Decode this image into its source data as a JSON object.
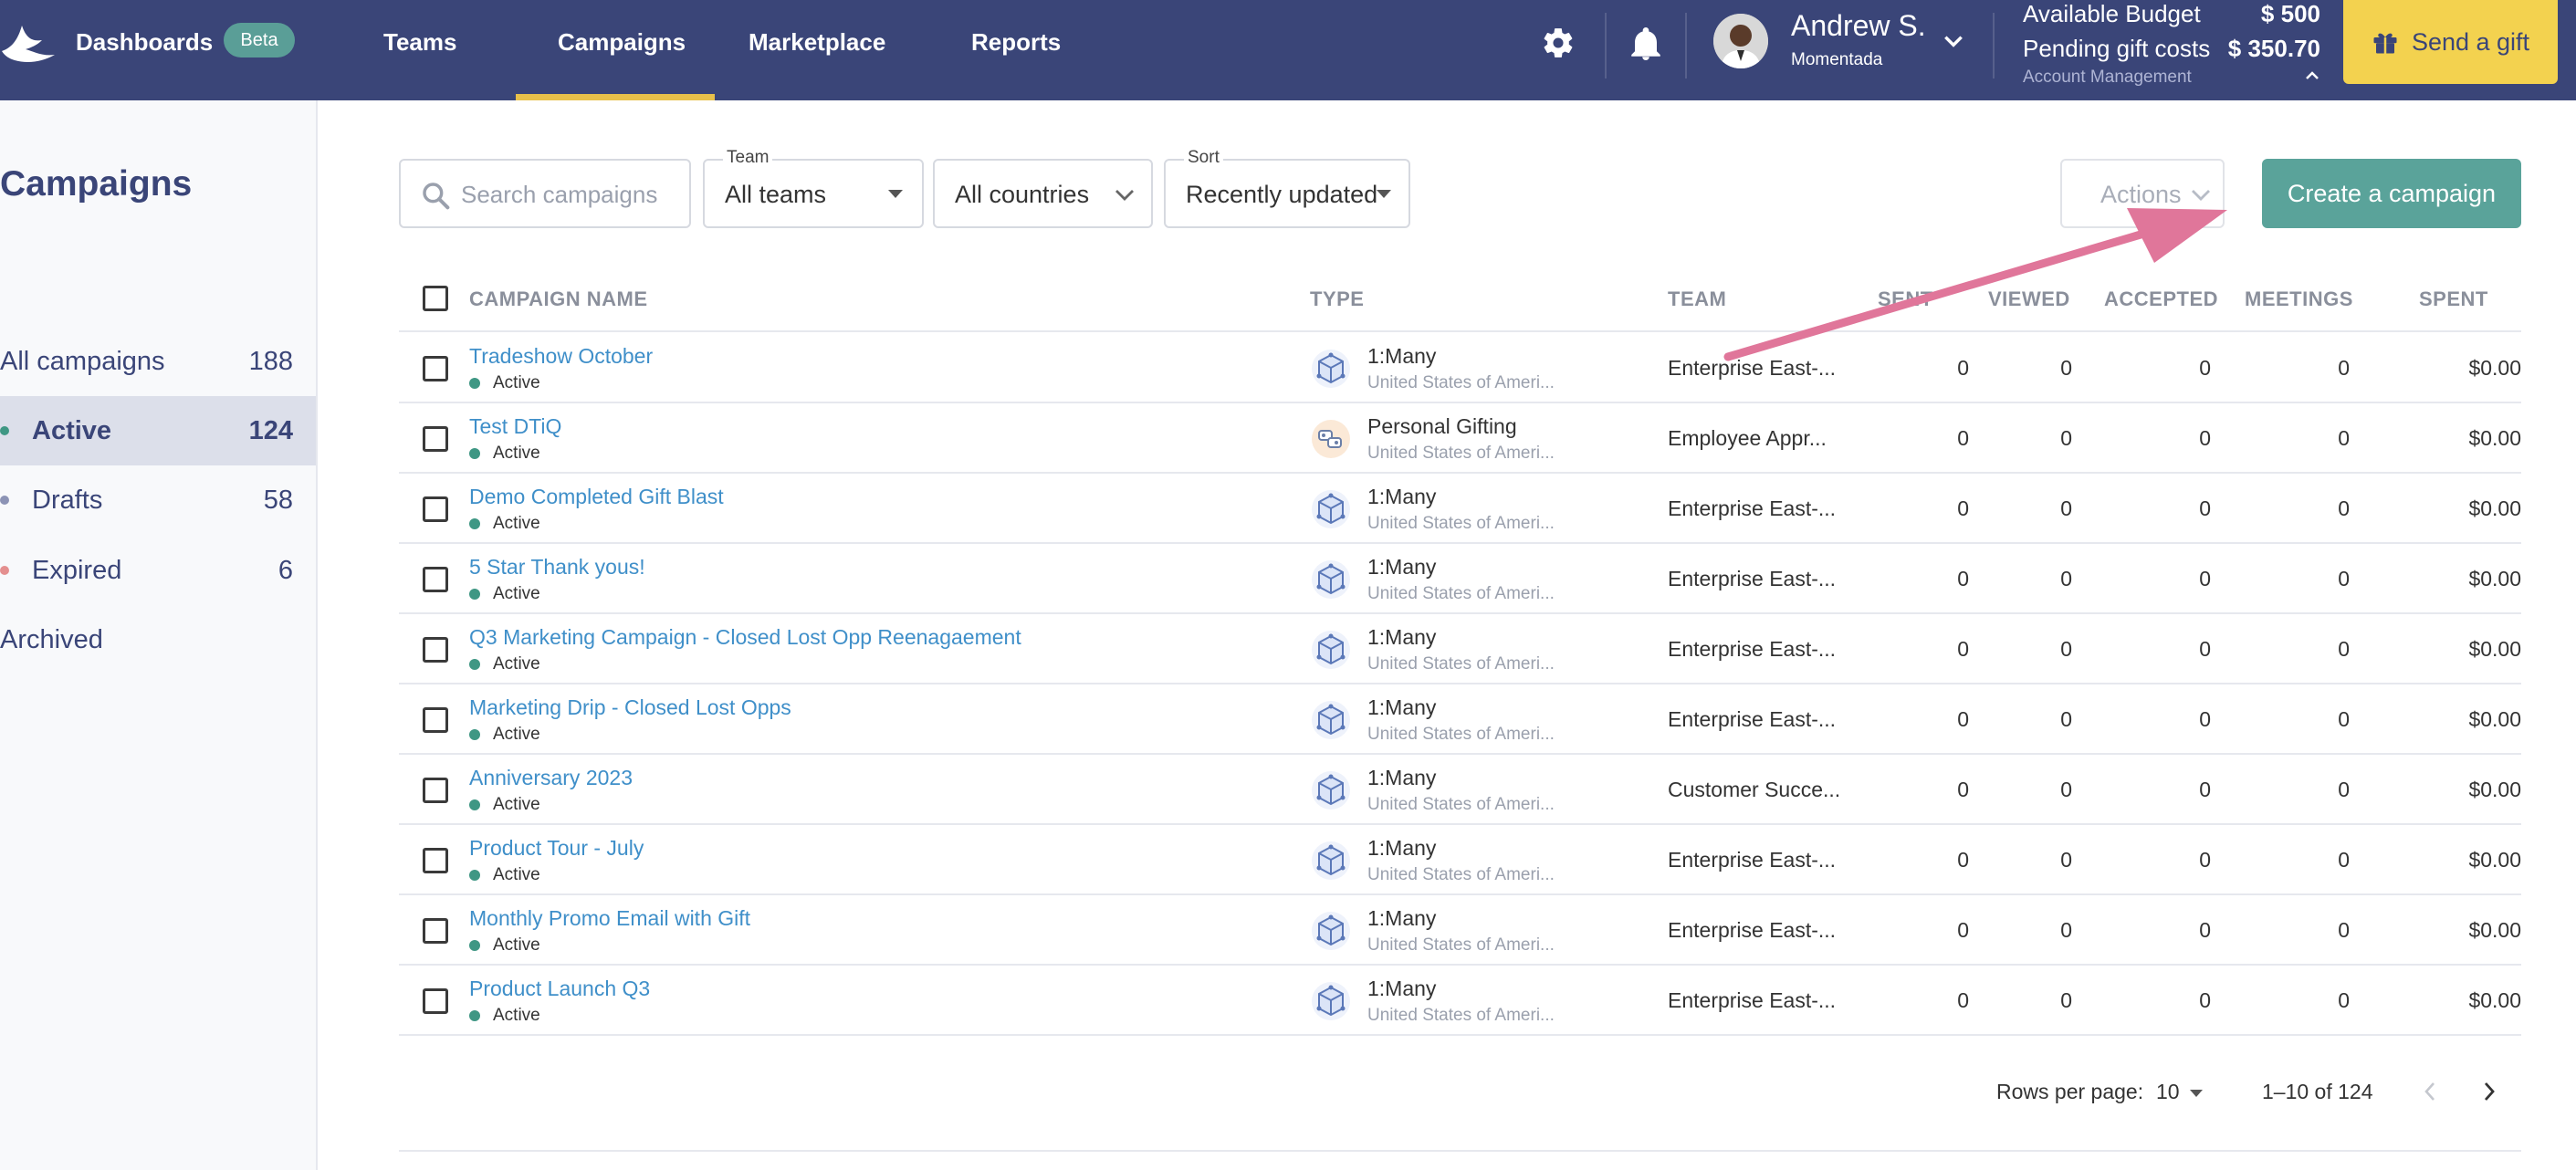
{
  "colors": {
    "nav_bg": "#3a4578",
    "accent_green": "#5aa39a",
    "gift_yellow": "#f3d24f",
    "link_blue": "#3f8fc9",
    "status_green": "#3f9784",
    "annotation_pink": "#e0769a"
  },
  "nav": {
    "dashboards": "Dashboards",
    "beta": "Beta",
    "links": [
      "Teams",
      "Campaigns",
      "Marketplace",
      "Reports"
    ],
    "active_link": "Campaigns",
    "user": {
      "name": "Andrew S.",
      "org": "Momentada"
    },
    "budget": {
      "available_label": "Available Budget",
      "available_value": "$ 500",
      "pending_label": "Pending gift costs",
      "pending_value": "$ 350.70",
      "account_management": "Account Management"
    },
    "send_gift": "Send a gift",
    "icons": [
      "logo-bird-icon",
      "gear-icon",
      "bell-icon",
      "chevron-down-icon",
      "chevron-up-icon",
      "gift-icon"
    ]
  },
  "sidebar": {
    "title": "Campaigns",
    "items": [
      {
        "label": "All campaigns",
        "count": "188",
        "dot": ""
      },
      {
        "label": "Active",
        "count": "124",
        "dot": "#3f9784"
      },
      {
        "label": "Drafts",
        "count": "58",
        "dot": "#8c93b5"
      },
      {
        "label": "Expired",
        "count": "6",
        "dot": "#e48f8f"
      },
      {
        "label": "Archived",
        "count": "",
        "dot": ""
      }
    ],
    "selected": "Active"
  },
  "filters": {
    "search_placeholder": "Search campaigns",
    "team_label": "Team",
    "team_value": "All teams",
    "country_value": "All countries",
    "sort_label": "Sort",
    "sort_value": "Recently updated",
    "actions": "Actions",
    "create": "Create a campaign"
  },
  "table": {
    "headers": {
      "name": "CAMPAIGN NAME",
      "type": "TYPE",
      "team": "TEAM",
      "sent": "SENT",
      "viewed": "VIEWED",
      "accepted": "ACCEPTED",
      "meetings": "MEETINGS",
      "spent": "SPENT"
    },
    "rows": [
      {
        "name": "Tradeshow October",
        "status": "Active",
        "type": "1:Many",
        "type_icon": "one-to-many-icon",
        "country": "United States of Ameri...",
        "team": "Enterprise East-...",
        "sent": "0",
        "viewed": "0",
        "accepted": "0",
        "meetings": "0",
        "spent": "$0.00"
      },
      {
        "name": "Test DTiQ",
        "status": "Active",
        "type": "Personal Gifting",
        "type_icon": "personal-gifting-icon",
        "country": "United States of Ameri...",
        "team": "Employee Appr...",
        "sent": "0",
        "viewed": "0",
        "accepted": "0",
        "meetings": "0",
        "spent": "$0.00"
      },
      {
        "name": "Demo Completed Gift Blast",
        "status": "Active",
        "type": "1:Many",
        "type_icon": "one-to-many-icon",
        "country": "United States of Ameri...",
        "team": "Enterprise East-...",
        "sent": "0",
        "viewed": "0",
        "accepted": "0",
        "meetings": "0",
        "spent": "$0.00"
      },
      {
        "name": "5 Star Thank yous!",
        "status": "Active",
        "type": "1:Many",
        "type_icon": "one-to-many-icon",
        "country": "United States of Ameri...",
        "team": "Enterprise East-...",
        "sent": "0",
        "viewed": "0",
        "accepted": "0",
        "meetings": "0",
        "spent": "$0.00"
      },
      {
        "name": "Q3 Marketing Campaign - Closed Lost Opp Reenagaement",
        "status": "Active",
        "type": "1:Many",
        "type_icon": "one-to-many-icon",
        "country": "United States of Ameri...",
        "team": "Enterprise East-...",
        "sent": "0",
        "viewed": "0",
        "accepted": "0",
        "meetings": "0",
        "spent": "$0.00"
      },
      {
        "name": "Marketing Drip - Closed Lost Opps",
        "status": "Active",
        "type": "1:Many",
        "type_icon": "one-to-many-icon",
        "country": "United States of Ameri...",
        "team": "Enterprise East-...",
        "sent": "0",
        "viewed": "0",
        "accepted": "0",
        "meetings": "0",
        "spent": "$0.00"
      },
      {
        "name": "Anniversary 2023",
        "status": "Active",
        "type": "1:Many",
        "type_icon": "one-to-many-icon",
        "country": "United States of Ameri...",
        "team": "Customer Succe...",
        "sent": "0",
        "viewed": "0",
        "accepted": "0",
        "meetings": "0",
        "spent": "$0.00"
      },
      {
        "name": "Product Tour - July",
        "status": "Active",
        "type": "1:Many",
        "type_icon": "one-to-many-icon",
        "country": "United States of Ameri...",
        "team": "Enterprise East-...",
        "sent": "0",
        "viewed": "0",
        "accepted": "0",
        "meetings": "0",
        "spent": "$0.00"
      },
      {
        "name": "Monthly Promo Email with Gift",
        "status": "Active",
        "type": "1:Many",
        "type_icon": "one-to-many-icon",
        "country": "United States of Ameri...",
        "team": "Enterprise East-...",
        "sent": "0",
        "viewed": "0",
        "accepted": "0",
        "meetings": "0",
        "spent": "$0.00"
      },
      {
        "name": "Product Launch Q3",
        "status": "Active",
        "type": "1:Many",
        "type_icon": "one-to-many-icon",
        "country": "United States of Ameri...",
        "team": "Enterprise East-...",
        "sent": "0",
        "viewed": "0",
        "accepted": "0",
        "meetings": "0",
        "spent": "$0.00"
      }
    ]
  },
  "pagination": {
    "rows_label": "Rows per page:",
    "rows_value": "10",
    "range": "1–10 of 124"
  }
}
